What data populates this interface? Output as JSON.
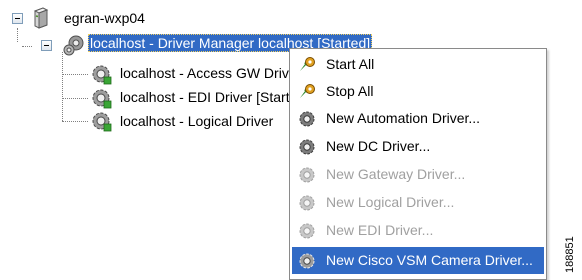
{
  "tree": {
    "root_label": "egran-wxp04",
    "driver_manager_label": "localhost - Driver Manager localhost [Started]",
    "children": [
      {
        "label": "localhost - Access GW Driver"
      },
      {
        "label": "localhost - EDI Driver [Started]"
      },
      {
        "label": "localhost - Logical Driver"
      }
    ]
  },
  "context_menu": {
    "items": [
      {
        "label": "Start All",
        "icon": "start-all-icon",
        "enabled": true
      },
      {
        "label": "Stop All",
        "icon": "stop-all-icon",
        "enabled": true
      },
      {
        "label": "New Automation Driver...",
        "icon": "driver-gear-icon",
        "enabled": true
      },
      {
        "label": "New DC Driver...",
        "icon": "driver-gear-icon",
        "enabled": true
      },
      {
        "label": "New Gateway Driver...",
        "icon": "driver-gear-icon",
        "enabled": false
      },
      {
        "label": "New Logical Driver...",
        "icon": "driver-gear-icon",
        "enabled": false
      },
      {
        "label": "New EDI Driver...",
        "icon": "driver-gear-icon",
        "enabled": false
      },
      {
        "label": "New Cisco VSM Camera Driver...",
        "icon": "driver-gear-icon",
        "enabled": true,
        "highlighted": true
      }
    ]
  },
  "figure_code": "188851",
  "colors": {
    "selection": "#316ac5",
    "disabled_text": "#a0a0a0",
    "tree_line": "#808080"
  }
}
